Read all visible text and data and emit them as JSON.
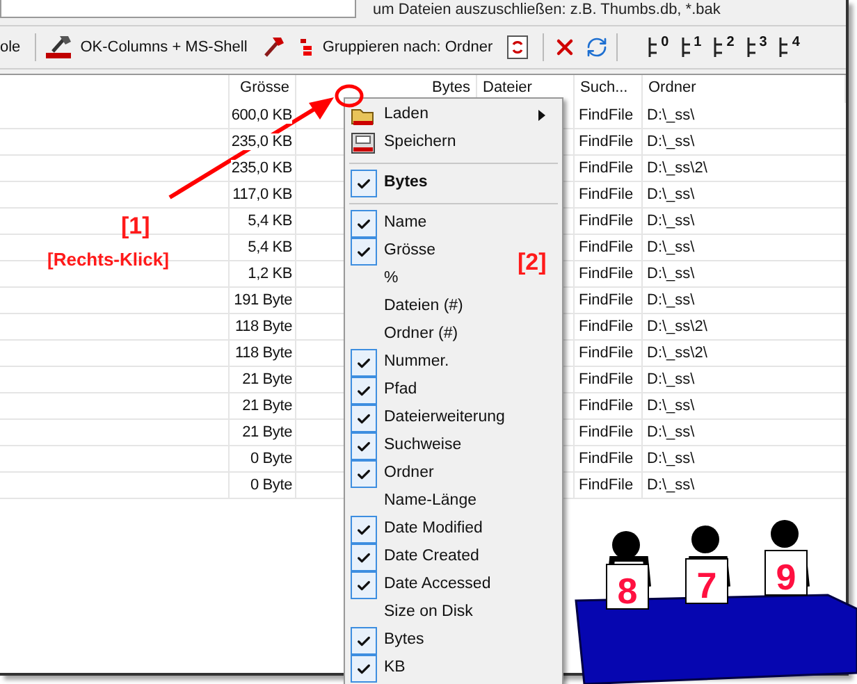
{
  "filter_hint": "um Dateien auszuschließen: z.B. Thumbs.db, *.bak",
  "toolbar": {
    "left_label": "ole",
    "columns_button": "OK-Columns + MS-Shell",
    "group_button": "Gruppieren nach: Ordner",
    "level_buttons": [
      "0",
      "1",
      "2",
      "3",
      "4"
    ]
  },
  "table": {
    "columns": [
      "",
      "Grösse",
      "Bytes",
      "Dateier",
      "Such...",
      "Ordner"
    ],
    "rows": [
      {
        "size": "600,0 KB",
        "search": "FindFile",
        "folder": "D:\\_ss\\"
      },
      {
        "size": "235,0 KB",
        "search": "FindFile",
        "folder": "D:\\_ss\\"
      },
      {
        "size": "235,0 KB",
        "search": "FindFile",
        "folder": "D:\\_ss\\2\\"
      },
      {
        "size": "117,0 KB",
        "search": "FindFile",
        "folder": "D:\\_ss\\"
      },
      {
        "size": "5,4 KB",
        "search": "FindFile",
        "folder": "D:\\_ss\\"
      },
      {
        "size": "5,4 KB",
        "search": "FindFile",
        "folder": "D:\\_ss\\"
      },
      {
        "size": "1,2 KB",
        "search": "FindFile",
        "folder": "D:\\_ss\\"
      },
      {
        "size": "191 Byte",
        "search": "FindFile",
        "folder": "D:\\_ss\\"
      },
      {
        "size": "118 Byte",
        "search": "FindFile",
        "folder": "D:\\_ss\\2\\"
      },
      {
        "size": "118 Byte",
        "search": "FindFile",
        "folder": "D:\\_ss\\2\\"
      },
      {
        "size": "21 Byte",
        "search": "FindFile",
        "folder": "D:\\_ss\\"
      },
      {
        "size": "21 Byte",
        "search": "FindFile",
        "folder": "D:\\_ss\\"
      },
      {
        "size": "21 Byte",
        "search": "FindFile",
        "folder": "D:\\_ss\\"
      },
      {
        "size": "0 Byte",
        "search": "FindFile",
        "folder": "D:\\_ss\\"
      },
      {
        "size": "0 Byte",
        "search": "FindFile",
        "folder": "D:\\_ss\\"
      }
    ]
  },
  "column_menu": {
    "items": [
      {
        "kind": "load",
        "label": "Laden"
      },
      {
        "kind": "save",
        "label": "Speichern"
      },
      {
        "kind": "separator"
      },
      {
        "kind": "header",
        "label": "Bytes",
        "checked": true
      },
      {
        "kind": "separator"
      },
      {
        "kind": "check",
        "label": "Name",
        "checked": true
      },
      {
        "kind": "check",
        "label": "Grösse",
        "checked": true
      },
      {
        "kind": "check",
        "label": "%",
        "checked": false
      },
      {
        "kind": "check",
        "label": "Dateien (#)",
        "checked": false
      },
      {
        "kind": "check",
        "label": "Ordner (#)",
        "checked": false
      },
      {
        "kind": "check",
        "label": "Nummer.",
        "checked": true
      },
      {
        "kind": "check",
        "label": "Pfad",
        "checked": true
      },
      {
        "kind": "check",
        "label": "Dateierweiterung",
        "checked": true
      },
      {
        "kind": "check",
        "label": "Suchweise",
        "checked": true
      },
      {
        "kind": "check",
        "label": "Ordner",
        "checked": true
      },
      {
        "kind": "check",
        "label": "Name-Länge",
        "checked": false
      },
      {
        "kind": "check",
        "label": "Date Modified",
        "checked": true
      },
      {
        "kind": "check",
        "label": "Date Created",
        "checked": true
      },
      {
        "kind": "check",
        "label": "Date Accessed",
        "checked": true
      },
      {
        "kind": "check",
        "label": "Size on Disk",
        "checked": false
      },
      {
        "kind": "check",
        "label": "Bytes",
        "checked": true
      },
      {
        "kind": "check",
        "label": "KB",
        "checked": true
      }
    ]
  },
  "annotations": {
    "step_1": "[1]",
    "step_1_hint": "[Rechts-Klick]",
    "step_2": "[2]"
  },
  "judge_cards": [
    "8",
    "7",
    "9"
  ]
}
